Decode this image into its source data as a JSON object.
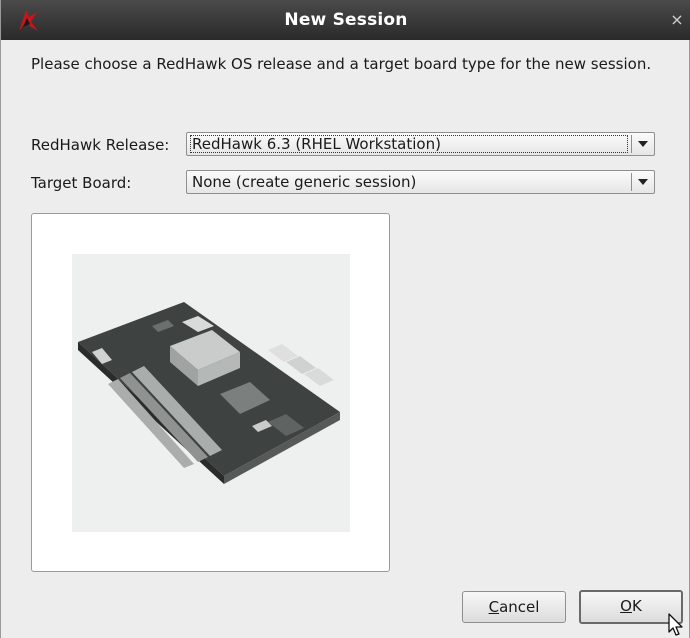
{
  "window": {
    "title": "New Session",
    "close_glyph": "×",
    "app_icon": "redhawk-logo-icon"
  },
  "instructions": "Please choose a RedHawk OS release and a target board type for the new session.",
  "release": {
    "label": "RedHawk Release:",
    "value": "RedHawk 6.3 (RHEL Workstation)"
  },
  "board": {
    "label": "Target Board:",
    "value": "None (create generic session)"
  },
  "preview": {
    "image": "motherboard-image"
  },
  "buttons": {
    "cancel_mnemonic": "C",
    "cancel_rest": "ancel",
    "ok_mnemonic": "O",
    "ok_rest": "K"
  },
  "colors": {
    "titlebar": "#333333",
    "dialog_bg": "#ededed",
    "accent_red": "#c4161c"
  }
}
